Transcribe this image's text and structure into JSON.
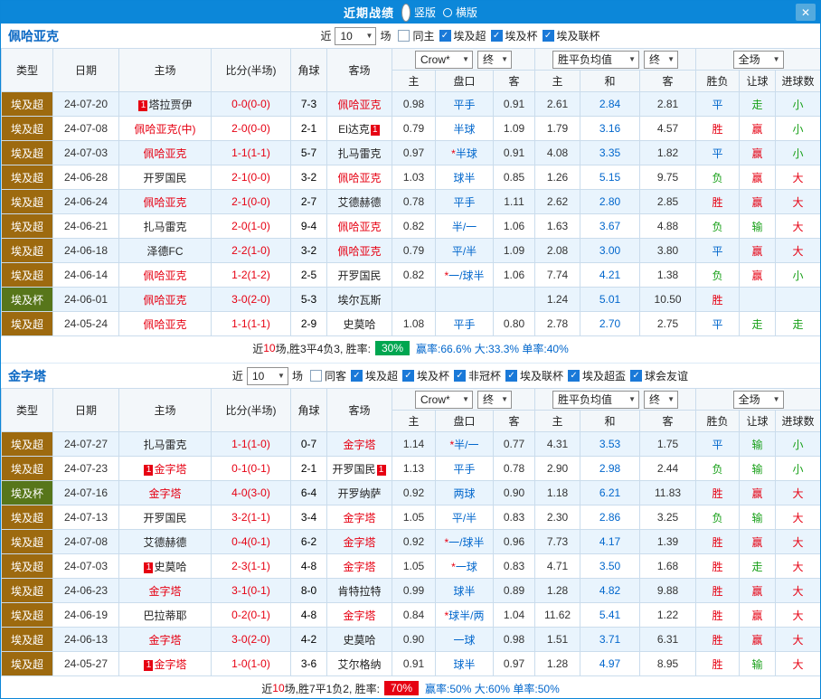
{
  "titlebar": {
    "title": "近期战绩",
    "radios": [
      {
        "label": "竖版",
        "selected": true
      },
      {
        "label": "横版",
        "selected": false
      }
    ],
    "close": "✕"
  },
  "colors": {
    "titlebar_blue": "#0c87d9",
    "team_header_blue": "#0a68c4",
    "link_blue": "#0066cc",
    "red": "#e60012",
    "green": "#18a018",
    "row_alt": "#e9f4fd",
    "league": {
      "埃及超": "#9d6a0f",
      "埃及杯": "#57761a"
    },
    "result": {
      "胜": "#e60012",
      "平": "#0066cc",
      "负": "#18a018"
    },
    "outcome": {
      "赢": "#e60012",
      "输": "#18a018",
      "走": "#18a018",
      "大": "#e60012",
      "小": "#18a018"
    },
    "badge": {
      "green": "#00a650",
      "red": "#e60012"
    }
  },
  "table_headers": {
    "type": "类型",
    "date": "日期",
    "home": "主场",
    "score": "比分(半场)",
    "corner": "角球",
    "away": "客场",
    "odds_company": "Crow*",
    "final_label": "终",
    "o_home": "主",
    "o_hcap": "盘口",
    "o_away": "客",
    "wdl": "胜平负均值",
    "w_home": "主",
    "w_draw": "和",
    "w_away": "客",
    "result": "胜负",
    "hcap_result": "让球",
    "goals": "进球数",
    "scope": "全场"
  },
  "sections": [
    {
      "team": "佩哈亚克",
      "near_label": "近",
      "near_value": "10",
      "games_label": "场",
      "checkboxes": [
        {
          "label": "同主",
          "checked": false
        },
        {
          "label": "埃及超",
          "checked": true
        },
        {
          "label": "埃及杯",
          "checked": true
        },
        {
          "label": "埃及联杯",
          "checked": true
        }
      ],
      "rows": [
        {
          "league": "埃及超",
          "date": "24-07-20",
          "home": "塔拉贾伊",
          "home_badge": "1",
          "home_badge_pos": "before",
          "home_red": false,
          "score": "0-0(0-0)",
          "corner": "7-3",
          "away": "佩哈亚克",
          "away_red": true,
          "o1": "0.98",
          "hcap": "平手",
          "o2": "0.91",
          "w1": "2.61",
          "w2": "2.84",
          "w3": "2.81",
          "res": "平",
          "hres": "走",
          "goals": "小"
        },
        {
          "league": "埃及超",
          "date": "24-07-08",
          "home": "佩哈亚克(中)",
          "home_red": true,
          "score": "2-0(0-0)",
          "corner": "2-1",
          "away": "El达克",
          "away_badge": "1",
          "away_badge_pos": "after",
          "away_red": false,
          "o1": "0.79",
          "hcap": "半球",
          "o2": "1.09",
          "w1": "1.79",
          "w2": "3.16",
          "w3": "4.57",
          "res": "胜",
          "hres": "赢",
          "goals": "小"
        },
        {
          "league": "埃及超",
          "date": "24-07-03",
          "home": "佩哈亚克",
          "home_red": true,
          "score": "1-1(1-1)",
          "corner": "5-7",
          "away": "扎马雷克",
          "away_red": false,
          "o1": "0.97",
          "hcap": "*半球",
          "o2": "0.91",
          "w1": "4.08",
          "w2": "3.35",
          "w3": "1.82",
          "res": "平",
          "hres": "赢",
          "goals": "小"
        },
        {
          "league": "埃及超",
          "date": "24-06-28",
          "home": "开罗国民",
          "home_red": false,
          "score": "2-1(0-0)",
          "corner": "3-2",
          "away": "佩哈亚克",
          "away_red": true,
          "o1": "1.03",
          "hcap": "球半",
          "o2": "0.85",
          "w1": "1.26",
          "w2": "5.15",
          "w3": "9.75",
          "res": "负",
          "hres": "赢",
          "goals": "大"
        },
        {
          "league": "埃及超",
          "date": "24-06-24",
          "home": "佩哈亚克",
          "home_red": true,
          "score": "2-1(0-0)",
          "corner": "2-7",
          "away": "艾德赫德",
          "away_red": false,
          "o1": "0.78",
          "hcap": "平手",
          "o2": "1.11",
          "w1": "2.62",
          "w2": "2.80",
          "w3": "2.85",
          "res": "胜",
          "hres": "赢",
          "goals": "大"
        },
        {
          "league": "埃及超",
          "date": "24-06-21",
          "home": "扎马雷克",
          "home_red": false,
          "score": "2-0(1-0)",
          "corner": "9-4",
          "away": "佩哈亚克",
          "away_red": true,
          "o1": "0.82",
          "hcap": "半/一",
          "o2": "1.06",
          "w1": "1.63",
          "w2": "3.67",
          "w3": "4.88",
          "res": "负",
          "hres": "输",
          "goals": "大"
        },
        {
          "league": "埃及超",
          "date": "24-06-18",
          "home": "泽德FC",
          "home_red": false,
          "score": "2-2(1-0)",
          "corner": "3-2",
          "away": "佩哈亚克",
          "away_red": true,
          "o1": "0.79",
          "hcap": "平/半",
          "o2": "1.09",
          "w1": "2.08",
          "w2": "3.00",
          "w3": "3.80",
          "res": "平",
          "hres": "赢",
          "goals": "大"
        },
        {
          "league": "埃及超",
          "date": "24-06-14",
          "home": "佩哈亚克",
          "home_red": true,
          "score": "1-2(1-2)",
          "corner": "2-5",
          "away": "开罗国民",
          "away_red": false,
          "o1": "0.82",
          "hcap": "*一/球半",
          "o2": "1.06",
          "w1": "7.74",
          "w2": "4.21",
          "w3": "1.38",
          "res": "负",
          "hres": "赢",
          "goals": "小"
        },
        {
          "league": "埃及杯",
          "date": "24-06-01",
          "home": "佩哈亚克",
          "home_red": true,
          "score": "3-0(2-0)",
          "corner": "5-3",
          "away": "埃尔瓦斯",
          "away_red": false,
          "o1": "",
          "hcap": "",
          "o2": "",
          "w1": "1.24",
          "w2": "5.01",
          "w3": "10.50",
          "res": "胜",
          "hres": "",
          "goals": ""
        },
        {
          "league": "埃及超",
          "date": "24-05-24",
          "home": "佩哈亚克",
          "home_red": true,
          "score": "1-1(1-1)",
          "corner": "2-9",
          "away": "史莫哈",
          "away_red": false,
          "o1": "1.08",
          "hcap": "平手",
          "o2": "0.80",
          "w1": "2.78",
          "w2": "2.70",
          "w3": "2.75",
          "res": "平",
          "hres": "走",
          "goals": "走"
        }
      ],
      "stats": {
        "pre": "近",
        "count": "10",
        "mid": "场,胜3平4负3, 胜率:",
        "rate": "30%",
        "badge": "green",
        "post": "赢率:66.6% 大:33.3% 单率:40%"
      }
    },
    {
      "team": "金字塔",
      "near_label": "近",
      "near_value": "10",
      "games_label": "场",
      "checkboxes": [
        {
          "label": "同客",
          "checked": false
        },
        {
          "label": "埃及超",
          "checked": true
        },
        {
          "label": "埃及杯",
          "checked": true
        },
        {
          "label": "非冠杯",
          "checked": true
        },
        {
          "label": "埃及联杯",
          "checked": true
        },
        {
          "label": "埃及超盃",
          "checked": true
        },
        {
          "label": "球会友谊",
          "checked": true
        }
      ],
      "rows": [
        {
          "league": "埃及超",
          "date": "24-07-27",
          "home": "扎马雷克",
          "home_red": false,
          "score": "1-1(1-0)",
          "corner": "0-7",
          "away": "金字塔",
          "away_red": true,
          "o1": "1.14",
          "hcap": "*半/一",
          "o2": "0.77",
          "w1": "4.31",
          "w2": "3.53",
          "w3": "1.75",
          "res": "平",
          "hres": "输",
          "goals": "小"
        },
        {
          "league": "埃及超",
          "date": "24-07-23",
          "home": "金字塔",
          "home_badge": "1",
          "home_badge_pos": "before",
          "home_red": true,
          "score": "0-1(0-1)",
          "corner": "2-1",
          "away": "开罗国民",
          "away_badge": "1",
          "away_badge_pos": "after",
          "away_red": false,
          "o1": "1.13",
          "hcap": "平手",
          "o2": "0.78",
          "w1": "2.90",
          "w2": "2.98",
          "w3": "2.44",
          "res": "负",
          "hres": "输",
          "goals": "小"
        },
        {
          "league": "埃及杯",
          "date": "24-07-16",
          "home": "金字塔",
          "home_red": true,
          "score": "4-0(3-0)",
          "corner": "6-4",
          "away": "开罗纳萨",
          "away_red": false,
          "o1": "0.92",
          "hcap": "两球",
          "o2": "0.90",
          "w1": "1.18",
          "w2": "6.21",
          "w3": "11.83",
          "res": "胜",
          "hres": "赢",
          "goals": "大"
        },
        {
          "league": "埃及超",
          "date": "24-07-13",
          "home": "开罗国民",
          "home_red": false,
          "score": "3-2(1-1)",
          "corner": "3-4",
          "away": "金字塔",
          "away_red": true,
          "o1": "1.05",
          "hcap": "平/半",
          "o2": "0.83",
          "w1": "2.30",
          "w2": "2.86",
          "w3": "3.25",
          "res": "负",
          "hres": "输",
          "goals": "大"
        },
        {
          "league": "埃及超",
          "date": "24-07-08",
          "home": "艾德赫德",
          "home_red": false,
          "score": "0-4(0-1)",
          "corner": "6-2",
          "away": "金字塔",
          "away_red": true,
          "o1": "0.92",
          "hcap": "*一/球半",
          "o2": "0.96",
          "w1": "7.73",
          "w2": "4.17",
          "w3": "1.39",
          "res": "胜",
          "hres": "赢",
          "goals": "大"
        },
        {
          "league": "埃及超",
          "date": "24-07-03",
          "home": "史莫哈",
          "home_badge": "1",
          "home_badge_pos": "before",
          "home_red": false,
          "score": "2-3(1-1)",
          "corner": "4-8",
          "away": "金字塔",
          "away_red": true,
          "o1": "1.05",
          "hcap": "*一球",
          "o2": "0.83",
          "w1": "4.71",
          "w2": "3.50",
          "w3": "1.68",
          "res": "胜",
          "hres": "走",
          "goals": "大"
        },
        {
          "league": "埃及超",
          "date": "24-06-23",
          "home": "金字塔",
          "home_red": true,
          "score": "3-1(0-1)",
          "corner": "8-0",
          "away": "肯特拉特",
          "away_red": false,
          "o1": "0.99",
          "hcap": "球半",
          "o2": "0.89",
          "w1": "1.28",
          "w2": "4.82",
          "w3": "9.88",
          "res": "胜",
          "hres": "赢",
          "goals": "大"
        },
        {
          "league": "埃及超",
          "date": "24-06-19",
          "home": "巴拉蒂耶",
          "home_red": false,
          "score": "0-2(0-1)",
          "corner": "4-8",
          "away": "金字塔",
          "away_red": true,
          "o1": "0.84",
          "hcap": "*球半/两",
          "o2": "1.04",
          "w1": "11.62",
          "w2": "5.41",
          "w3": "1.22",
          "res": "胜",
          "hres": "赢",
          "goals": "大"
        },
        {
          "league": "埃及超",
          "date": "24-06-13",
          "home": "金字塔",
          "home_red": true,
          "score": "3-0(2-0)",
          "corner": "4-2",
          "away": "史莫哈",
          "away_red": false,
          "o1": "0.90",
          "hcap": "一球",
          "o2": "0.98",
          "w1": "1.51",
          "w2": "3.71",
          "w3": "6.31",
          "res": "胜",
          "hres": "赢",
          "goals": "大"
        },
        {
          "league": "埃及超",
          "date": "24-05-27",
          "home": "金字塔",
          "home_badge": "1",
          "home_badge_pos": "before",
          "home_red": true,
          "score": "1-0(1-0)",
          "corner": "3-6",
          "away": "艾尔格纳",
          "away_red": false,
          "o1": "0.91",
          "hcap": "球半",
          "o2": "0.97",
          "w1": "1.28",
          "w2": "4.97",
          "w3": "8.95",
          "res": "胜",
          "hres": "输",
          "goals": "大"
        }
      ],
      "stats": {
        "pre": "近",
        "count": "10",
        "mid": "场,胜7平1负2, 胜率:",
        "rate": "70%",
        "badge": "red",
        "post": "赢率:50% 大:60% 单率:50%"
      }
    }
  ]
}
